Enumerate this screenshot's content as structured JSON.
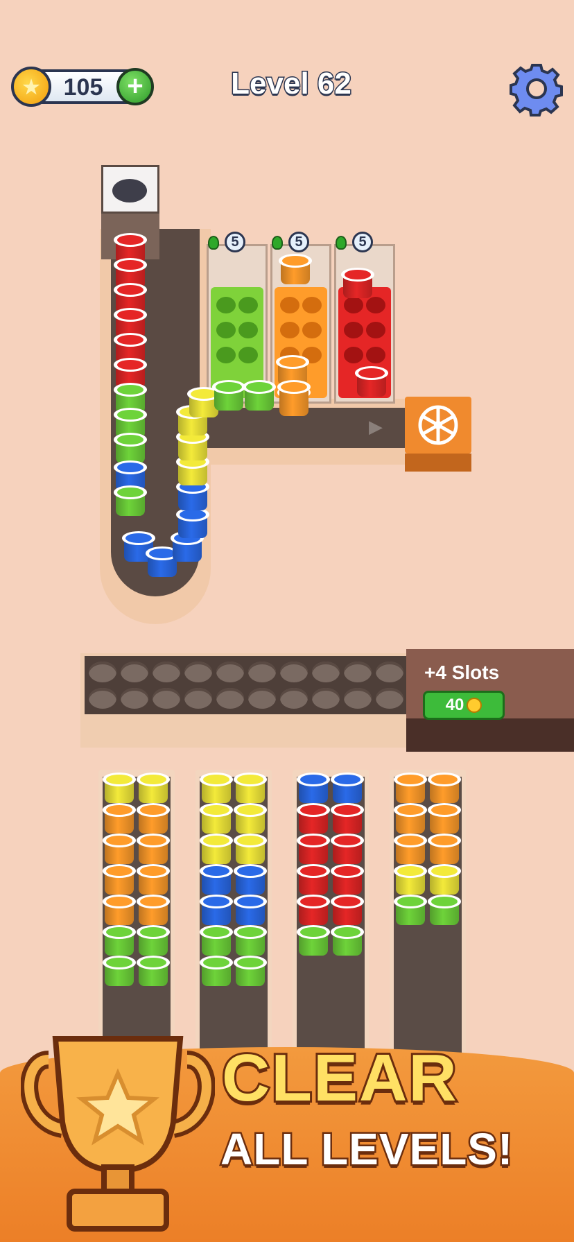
{
  "hud": {
    "coins": "105",
    "add_label": "+",
    "level_title": "Level 62"
  },
  "boxes": [
    {
      "color": "#7fd23a",
      "dark": "#4a9a1e",
      "count": "5"
    },
    {
      "color": "#ff9c2a",
      "dark": "#d46d0e",
      "count": "5"
    },
    {
      "color": "#e52626",
      "dark": "#a31212",
      "count": "5"
    }
  ],
  "holding": {
    "add_slots_label": "+4 Slots",
    "add_slots_price": "40"
  },
  "colors": {
    "red": "#e52626",
    "green": "#6ed33a",
    "yellow": "#f3ea3a",
    "blue": "#2a6ae8",
    "orange": "#ff9c2a"
  },
  "track_cups": [
    "red",
    "red",
    "red",
    "red",
    "red",
    "red",
    "green",
    "green",
    "green",
    "blue",
    "green",
    "blue",
    "blue",
    "blue",
    "blue",
    "blue",
    "yellow",
    "yellow",
    "yellow",
    "yellow",
    "green",
    "green",
    "orange",
    "orange",
    "orange"
  ],
  "columns": [
    {
      "left": [
        "yellow",
        "orange",
        "orange",
        "orange",
        "orange",
        "green",
        "green"
      ],
      "right": [
        "yellow",
        "orange",
        "orange",
        "orange",
        "orange",
        "green",
        "green"
      ]
    },
    {
      "left": [
        "yellow",
        "yellow",
        "yellow",
        "blue",
        "blue",
        "green",
        "green"
      ],
      "right": [
        "yellow",
        "yellow",
        "yellow",
        "blue",
        "blue",
        "green",
        "green"
      ]
    },
    {
      "left": [
        "blue",
        "red",
        "red",
        "red",
        "red",
        "green"
      ],
      "right": [
        "blue",
        "red",
        "red",
        "red",
        "red",
        "green"
      ]
    },
    {
      "left": [
        "orange",
        "orange",
        "orange",
        "yellow",
        "green"
      ],
      "right": [
        "orange",
        "orange",
        "orange",
        "yellow",
        "green"
      ]
    }
  ],
  "banner": {
    "title": "CLEAR",
    "subtitle": "ALL LEVELS!"
  }
}
